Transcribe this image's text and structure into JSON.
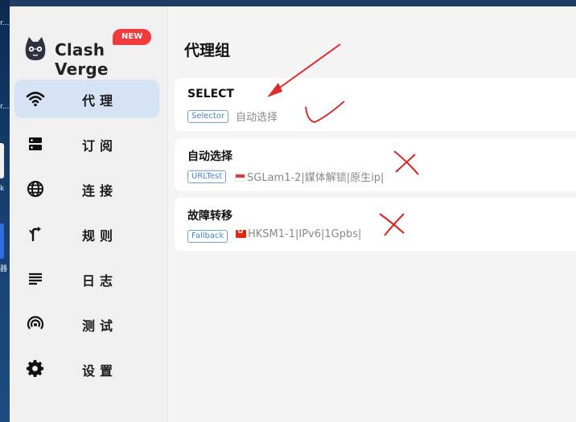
{
  "desktop": {
    "label1": "r...",
    "label2": "r...",
    "label3": "k",
    "label4": "器"
  },
  "app": {
    "brand": "Clash Verge",
    "badge": "NEW",
    "nav": [
      {
        "label": "代理",
        "icon": "wifi-icon",
        "active": true
      },
      {
        "label": "订阅",
        "icon": "subscription-icon",
        "active": false
      },
      {
        "label": "连接",
        "icon": "globe-icon",
        "active": false
      },
      {
        "label": "规则",
        "icon": "route-icon",
        "active": false
      },
      {
        "label": "日志",
        "icon": "log-icon",
        "active": false
      },
      {
        "label": "测试",
        "icon": "radar-icon",
        "active": false
      },
      {
        "label": "设置",
        "icon": "gear-icon",
        "active": false
      }
    ]
  },
  "main": {
    "title": "代理组",
    "groups": [
      {
        "name": "SELECT",
        "type": "Selector",
        "current": "自动选择",
        "flag": ""
      },
      {
        "name": "自动选择",
        "type": "URLTest",
        "current": "SGLam1-2|媒体解锁|原生ip|",
        "flag": "sg-flag-icon"
      },
      {
        "name": "故障转移",
        "type": "Fallback",
        "current": "HKSM1-1|IPv6|1Gpbs|",
        "flag": "hk-flag-icon"
      }
    ]
  },
  "annotations": {
    "arrow_color": "#e02a2a",
    "check_color": "#d62020",
    "cross_color": "#d62020"
  },
  "colors": {
    "active_nav": "#d6e3f5",
    "badge": "#ee3b3b",
    "tag_border": "#6fa0da"
  }
}
